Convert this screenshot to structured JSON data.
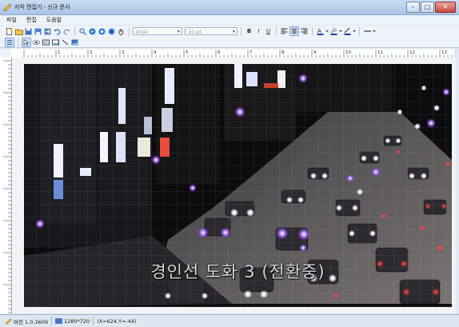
{
  "window": {
    "title": "자막 편집기 - 신규 문서",
    "buttons": [
      "–",
      "□",
      "✕"
    ]
  },
  "menu": [
    "파일",
    "편집",
    "도움말"
  ],
  "toolbar": {
    "font_family": "Arial",
    "font_size": "10 pt."
  },
  "ruler": {
    "h_labels": [
      "1",
      "2",
      "3",
      "4",
      "5",
      "6",
      "7",
      "8",
      "9",
      "10",
      "11",
      "12",
      "13"
    ]
  },
  "video": {
    "subtitle": "경인선 도화 3 (전환중)"
  },
  "status": {
    "version": "버전 1.0.3609",
    "resolution": "1280*720",
    "coords": "(X=624,Y=-44)"
  },
  "colors": {
    "titlebar": "#b7cfee",
    "subtitle_text": "#d9d9d9",
    "headlight": "#b15cff"
  }
}
